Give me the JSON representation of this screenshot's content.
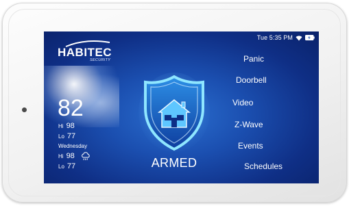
{
  "status": {
    "time": "Tue 5:35 PM",
    "wifi_icon": "wifi-icon",
    "battery_icon": "battery-charging-icon"
  },
  "brand": {
    "name": "HABITEC",
    "tagline": "SECURITY"
  },
  "weather": {
    "current_temp": "82",
    "today_hi_label": "Hi",
    "today_hi": "98",
    "today_lo_label": "Lo",
    "today_lo": "77",
    "forecast_day": "Wednesday",
    "forecast_hi_label": "Hi",
    "forecast_hi": "98",
    "forecast_lo_label": "Lo",
    "forecast_lo": "77",
    "forecast_icon": "rain-cloud-icon"
  },
  "system": {
    "state": "ARMED",
    "icon": "house-shield-icon"
  },
  "menu": {
    "panic": "Panic",
    "doorbell": "Doorbell",
    "video": "Video",
    "zwave": "Z-Wave",
    "events": "Events",
    "schedules": "Schedules"
  },
  "colors": {
    "screen_bg": "#1b4fb0",
    "shield_glow": "#6fd3ff",
    "bezel": "#f2f2f2"
  }
}
